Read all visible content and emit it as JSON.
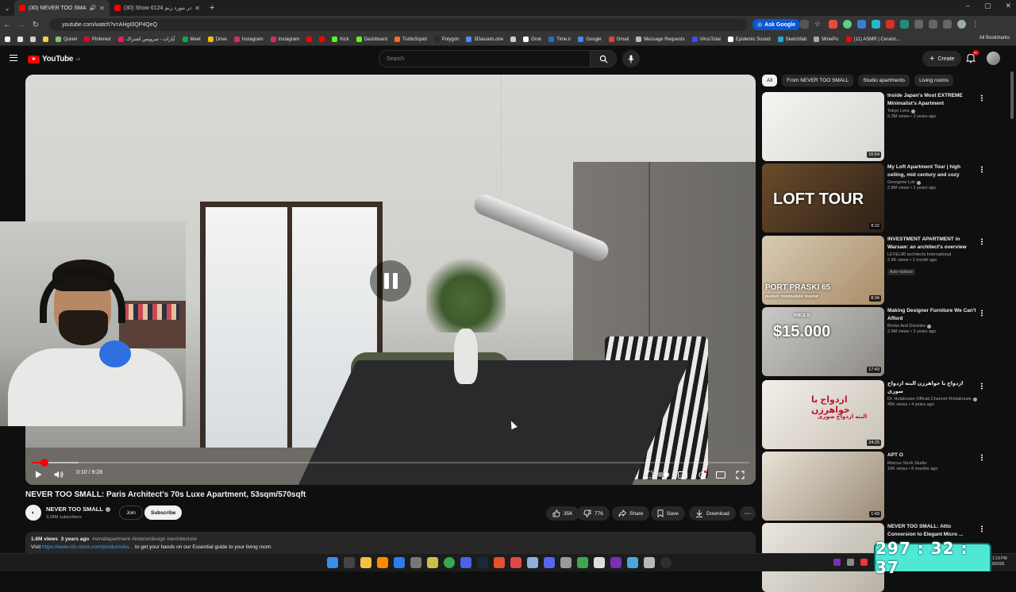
{
  "browser": {
    "tabs": [
      {
        "label": "(30) NEVER TOO SMALL: Pa",
        "active": true
      },
      {
        "label": "(30) Show 6124 آنها در مورد زنم",
        "active": false
      }
    ],
    "url": "youtube.com/watch?v=AHgI0QP4QeQ",
    "ask_google": "Ask Google",
    "bookmarks": [
      {
        "label": "",
        "color": "#f1f1f1"
      },
      {
        "label": "",
        "color": "#e0e0e0"
      },
      {
        "label": "",
        "color": "#d0d0d0"
      },
      {
        "label": "",
        "color": "#f5d142"
      },
      {
        "label": "Quixel",
        "color": "#7cc576"
      },
      {
        "label": "Pinterest",
        "color": "#e60023"
      },
      {
        "label": "آپارات - سرویس اشتراک",
        "color": "#ea1d5d"
      },
      {
        "label": "Meet",
        "color": "#00ac47"
      },
      {
        "label": "Drive",
        "color": "#fbbc04"
      },
      {
        "label": "Instagram",
        "color": "#d62976"
      },
      {
        "label": "Instagram",
        "color": "#d62976"
      },
      {
        "label": "",
        "color": "#ff0000"
      },
      {
        "label": "",
        "color": "#ff0000"
      },
      {
        "label": "Kick",
        "color": "#53fc18"
      },
      {
        "label": "Dashboard",
        "color": "#53fc18"
      },
      {
        "label": "TurboSquid",
        "color": "#f36f21"
      },
      {
        "label": "Polygon",
        "color": "#2b2b2b"
      },
      {
        "label": "3Dassets.one",
        "color": "#4b8bf4"
      },
      {
        "label": "",
        "color": "#cccccc"
      },
      {
        "label": "Grok",
        "color": "#ffffff"
      },
      {
        "label": "Time.ir",
        "color": "#1f6fd1"
      },
      {
        "label": "Google",
        "color": "#4285f4"
      },
      {
        "label": "Gmail",
        "color": "#ea4335"
      },
      {
        "label": "Message Requests",
        "color": "#bbbbbb"
      },
      {
        "label": "VirusTotal",
        "color": "#394eff"
      },
      {
        "label": "Epidemic Sound",
        "color": "#ffffff"
      },
      {
        "label": "Sketchfab",
        "color": "#1caad9"
      },
      {
        "label": "MinePic",
        "color": "#aaaaaa"
      },
      {
        "label": "(11) ASMR | Cerami...",
        "color": "#ff0000"
      }
    ],
    "all_bookmarks": "All Bookmarks"
  },
  "youtube": {
    "logo_text": "YouTube",
    "region": "DE",
    "search_placeholder": "Search",
    "create_label": "Create",
    "notif_count": "9+"
  },
  "player": {
    "time_current": "0:10",
    "time_total": "9:28",
    "progress_fraction": 0.0176,
    "buffer_fraction": 0.065,
    "state": "paused-overlay"
  },
  "video": {
    "title": "NEVER TOO SMALL: Paris Architect's 70s Luxe Apartment, 53sqm/570sqft",
    "channel": "NEVER TOO SMALL",
    "subscribers": "3.34M subscribers",
    "join": "Join",
    "subscribe": "Subscribe",
    "likes": "35K",
    "dislikes": "776",
    "share": "Share",
    "save": "Save",
    "download": "Download",
    "views": "1.6M views",
    "age": "3 years ago",
    "hashtags": "#smallapartment #interiordesign #architecture",
    "desc_prefix": "Visit",
    "desc_link": "https://www.nts-store.com/products/es...",
    "desc_suffix": "to get your hands on our Essential guide to your living room."
  },
  "chips": [
    {
      "label": "All",
      "active": true
    },
    {
      "label": "From NEVER TOO SMALL",
      "active": false
    },
    {
      "label": "Studio apartments",
      "active": false
    },
    {
      "label": "Living rooms",
      "active": false
    }
  ],
  "recommendations": [
    {
      "title": "Inside Japan's Most EXTREME Minimalist's Apartment",
      "channel": "Tokyo Lens",
      "verified": true,
      "views": "5.3M views",
      "age": "2 years ago",
      "duration": "16:54",
      "thumb_text": "",
      "bg": "linear-gradient(135deg,#f4f4f2,#d7d7d3)"
    },
    {
      "title": "My Loft Apartment Tour | high ceiling, mid century and cozy",
      "channel": "Georgene Loh",
      "verified": true,
      "views": "2.8M views",
      "age": "2 years ago",
      "duration": "8:22",
      "thumb_text": "LOFT TOUR",
      "bg": "linear-gradient(135deg,#6b4b2a,#2d2118)"
    },
    {
      "title": "INVESTMENT APARTMENT in Warsaw: an architect's overview",
      "channel": "LEVEL80 architects International",
      "verified": false,
      "views": "2.4K views",
      "age": "1 month ago",
      "duration": "8:34",
      "thumb_text": "PORT PRASKI 65",
      "thumb_sub": "modern minimalistic interior",
      "dubbed": "Auto-dubbed",
      "bg": "linear-gradient(135deg,#d8cbb5,#a88c66)"
    },
    {
      "title": "Making Designer Furniture We Can't Afford",
      "channel": "Bricks And Disorder",
      "verified": true,
      "views": "2.9M views",
      "age": "3 years ago",
      "duration": "17:43",
      "thumb_text": "$15.000",
      "thumb_sub": "PRICE IS",
      "bg": "linear-gradient(135deg,#c9c9c5,#8d8a84)"
    },
    {
      "title": "ازدواج با خواهرزن البته ازدواج صوری",
      "channel": "Dr. Holakouee Official Channel #Holakouee",
      "verified": true,
      "views": "45K views",
      "age": "4 years ago",
      "duration": "24:25",
      "thumb_text": "ازدواج با خواهرزن",
      "thumb_sub": "البته ازدواج صوری",
      "bg": "linear-gradient(135deg,#f3efe8,#c9c2b8)"
    },
    {
      "title": "APT O",
      "channel": "Marcus Stork Studio",
      "verified": false,
      "views": "16K views",
      "age": "8 months ago",
      "duration": "1:43",
      "thumb_text": "",
      "bg": "linear-gradient(135deg,#e8e2d8,#9b8b76)"
    },
    {
      "title": "NEVER TOO SMALL: Attic Conversion to Elegant Micro ...",
      "channel": "",
      "verified": false,
      "views": "",
      "age": "",
      "duration": "",
      "thumb_text": "",
      "bg": "linear-gradient(135deg,#e9e6e0,#b9b2a6)"
    }
  ],
  "overlay_timer": "297 : 32 : 37",
  "taskbar": {
    "clock_time": "1:19 PM",
    "clock_date": "8/2026"
  }
}
